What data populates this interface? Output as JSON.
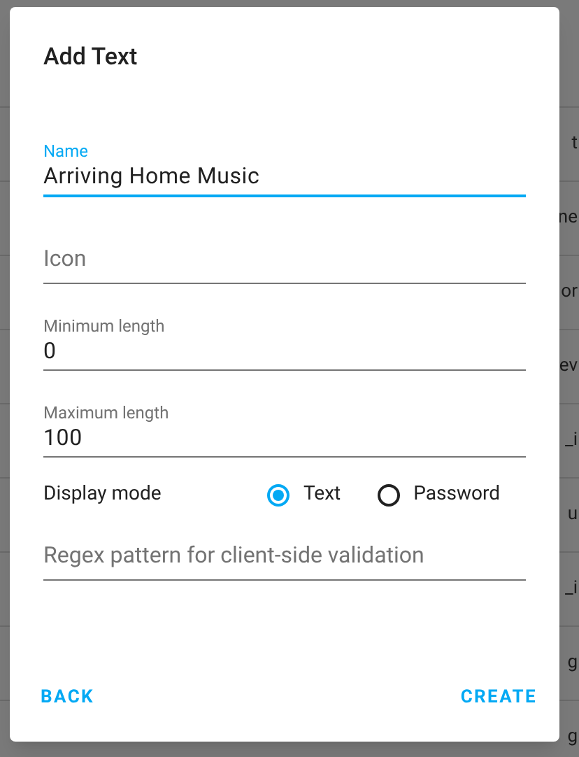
{
  "background_list": {
    "rows": [
      "t",
      "ne",
      "or",
      "ev",
      "_i",
      "u",
      "_i",
      "g",
      "g"
    ]
  },
  "dialog": {
    "title": "Add Text",
    "fields": [
      {
        "label": "Name",
        "value": "Arriving Home Music",
        "focused": true
      },
      {
        "placeholder": "Icon",
        "focused": false
      },
      {
        "label": "Minimum length",
        "value": "0",
        "focused": false
      },
      {
        "label": "Maximum length",
        "value": "100",
        "focused": false
      }
    ],
    "display_mode": {
      "label": "Display mode",
      "options": [
        {
          "label": "Text",
          "selected": true
        },
        {
          "label": "Password",
          "selected": false
        }
      ]
    },
    "regex_field": {
      "placeholder": "Regex pattern for client-side validation"
    },
    "buttons": {
      "back": "BACK",
      "create": "CREATE"
    }
  }
}
